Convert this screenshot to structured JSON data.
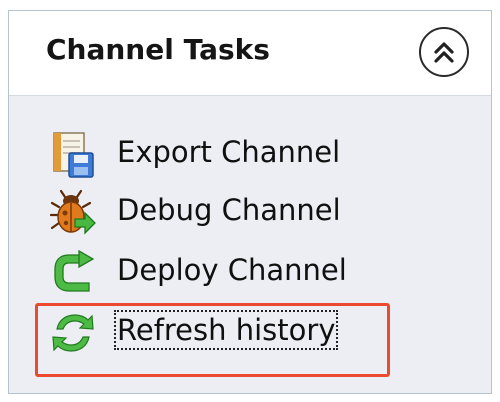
{
  "panel": {
    "title": "Channel Tasks",
    "collapse_icon": "double-chevron-up-icon"
  },
  "tasks": [
    {
      "label": "Export Channel",
      "icon": "export-channel-icon"
    },
    {
      "label": "Debug Channel",
      "icon": "debug-bug-icon"
    },
    {
      "label": "Deploy Channel",
      "icon": "deploy-arrow-icon"
    },
    {
      "label": "Refresh history",
      "icon": "refresh-arrows-icon",
      "focused": true
    }
  ],
  "colors": {
    "highlight": "#ea4b2e",
    "panel_background": "#eceef3",
    "icon_green": "#3fae3f"
  }
}
